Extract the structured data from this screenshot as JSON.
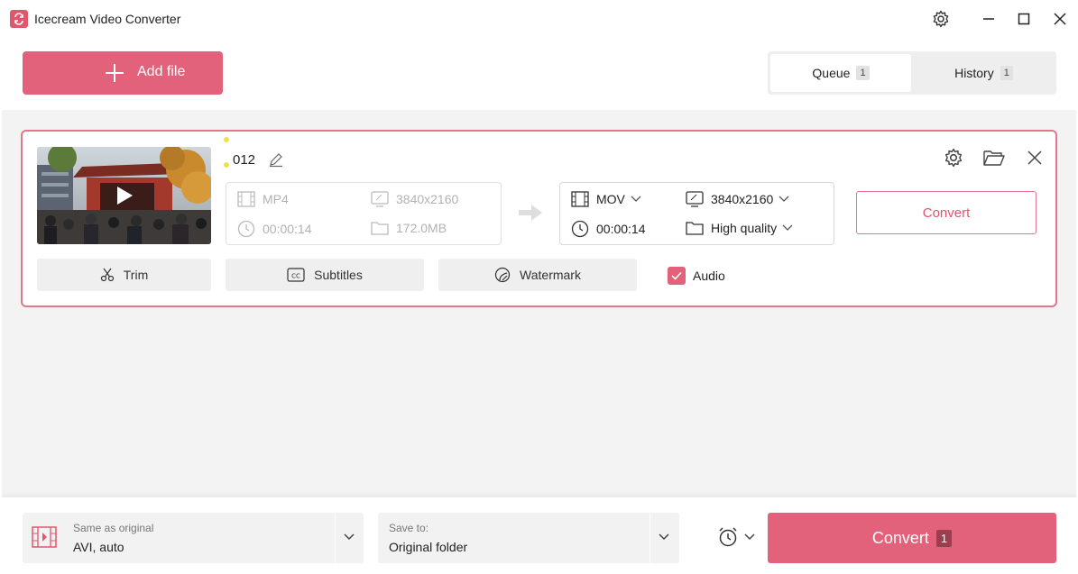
{
  "window": {
    "title": "Icecream Video Converter"
  },
  "header": {
    "add_file_label": "Add file",
    "tabs": [
      {
        "label": "Queue",
        "count": "1",
        "active": true
      },
      {
        "label": "History",
        "count": "1",
        "active": false
      }
    ]
  },
  "file_card": {
    "name": "012",
    "source": {
      "format": "MP4",
      "resolution": "3840x2160",
      "duration": "00:00:14",
      "size": "172.0MB"
    },
    "output": {
      "format": "MOV",
      "resolution": "3840x2160",
      "duration": "00:00:14",
      "quality": "High quality"
    },
    "convert_label": "Convert",
    "tools": {
      "trim": "Trim",
      "subtitles": "Subtitles",
      "watermark": "Watermark",
      "audio": "Audio"
    },
    "audio_checked": true
  },
  "footer": {
    "format_caption": "Same as original",
    "format_value": "AVI, auto",
    "save_caption": "Save to:",
    "save_value": "Original folder",
    "convert_label": "Convert",
    "convert_count": "1"
  },
  "colors": {
    "accent": "#e1627a",
    "card_border": "#e1778a",
    "background": "#f3f3f3"
  }
}
